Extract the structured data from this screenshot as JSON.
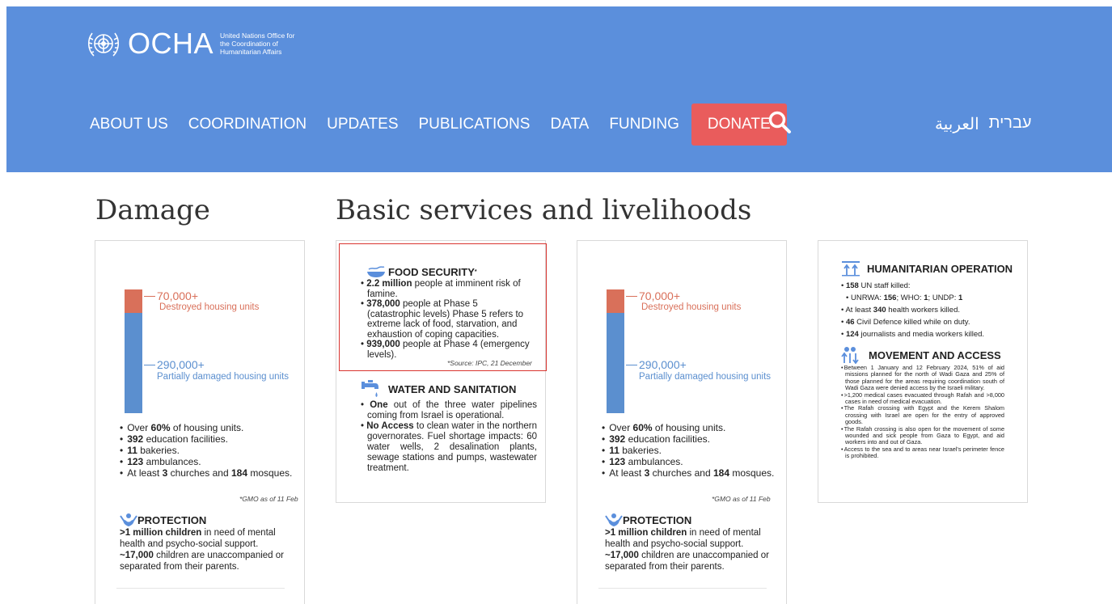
{
  "colors": {
    "header_bg": "#5b8fdc",
    "donate_bg": "#e95c5c",
    "destroyed": "#d9705a",
    "damaged": "#5b8fcf",
    "highlight_border": "#d9342f"
  },
  "header": {
    "logo_word": "OCHA",
    "logo_subtitle": "United Nations Office for the Coordination of Humanitarian Affairs",
    "nav": [
      "ABOUT US",
      "COORDINATION",
      "UPDATES",
      "PUBLICATIONS",
      "DATA",
      "FUNDING"
    ],
    "donate_label": "DONATE",
    "languages": [
      "العربية",
      "עברית"
    ],
    "icons": {
      "search": "search-icon",
      "logo": "un-emblem-icon"
    }
  },
  "sections": {
    "damage_title": "Damage",
    "basic_title": "Basic services and livelihoods"
  },
  "damage": {
    "destroyed_value": "70,000+",
    "destroyed_label": "Destroyed housing units",
    "damaged_value": "290,000+",
    "damaged_label": "Partially damaged housing units",
    "bullets": [
      [
        "Over ",
        "60%",
        " of housing units."
      ],
      [
        "",
        "392",
        " education facilities."
      ],
      [
        "",
        "11",
        " bakeries."
      ],
      [
        "",
        "123",
        " ambulances."
      ],
      [
        "At least ",
        "3",
        " churches and ",
        "184",
        " mosques."
      ]
    ],
    "note": "*GMO as of 11 Feb",
    "protection_title": "PROTECTION",
    "protection_line1_bold": ">1 million children",
    "protection_line1_rest": " in need of mental health and psycho-social support.",
    "protection_line2_bold": "~17,000",
    "protection_line2_rest": " children are unaccompanied or separated from their parents."
  },
  "food": {
    "title": "FOOD SECURITY",
    "title_mark": "*",
    "items": [
      [
        "2.2 million",
        " people at imminent risk of famine."
      ],
      [
        "378,000",
        " people at Phase 5 (catastrophic levels) Phase 5 refers to extreme lack of food, starvation, and exhaustion of coping capacities."
      ],
      [
        "939,000",
        " people at Phase 4 (emergency levels)."
      ]
    ],
    "source": "*Source: IPC, 21 December"
  },
  "water": {
    "title": "WATER AND SANITATION",
    "items": [
      [
        "One",
        " out of the three water pipelines coming from Israel is operational."
      ],
      [
        "No Access",
        " to clean water in the northern governorates. Fuel shortage impacts: 60 water wells, 2 desalination plants, sewage stations and pumps, wastewater treatment."
      ]
    ]
  },
  "humanitarian": {
    "title": "HUMANITARIAN OPERATION",
    "items": [
      [
        "",
        "158",
        " UN staff killed:"
      ],
      [
        "UNRWA: ",
        "156",
        "; WHO: ",
        "1",
        "; UNDP: ",
        "1"
      ],
      [
        "At least ",
        "340",
        " health workers killed."
      ],
      [
        "",
        "46",
        " Civil Defence killed while on duty."
      ],
      [
        "",
        "124",
        " journalists and media workers killed."
      ]
    ],
    "movement_title": "MOVEMENT AND ACCESS",
    "movement_items": [
      "Between 1 January and 12 February 2024, 51% of aid missions planned for the north of Wadi Gaza and 25% of those planned for the areas requiring coordination south of Wadi Gaza were denied access by the Israeli military.",
      ">1,200 medical cases evacuated through Rafah and >8,000 cases in need of medical evacuation.",
      "The Rafah crossing with Egypt and the Kerem Shalom crossing with Israel are open for the entry of approved goods.",
      "The Rafah crossing is also open for the movement of some wounded and sick people from Gaza to Egypt, and aid workers into and out of Gaza.",
      "Access to the sea and to areas near Israel's perimeter fence is prohibited."
    ]
  }
}
